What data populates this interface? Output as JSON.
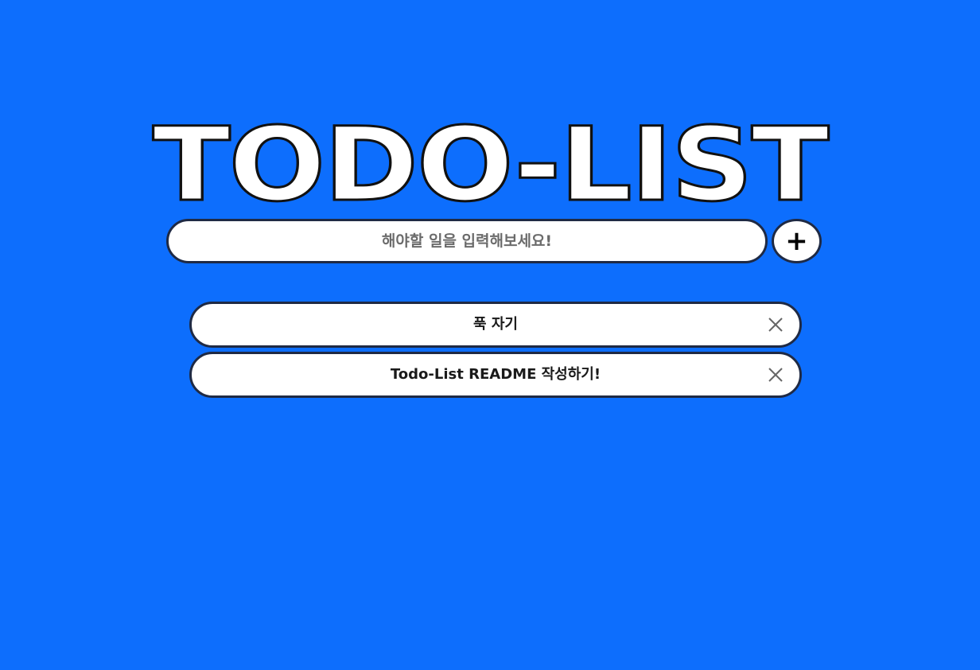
{
  "app": {
    "title": "TODO-LIST",
    "background_color": "#0d6efd"
  },
  "input": {
    "value": "",
    "placeholder": "해야할 일을 입력해보세요!"
  },
  "add_button": {
    "label": "+",
    "icon": "plus-icon"
  },
  "todos": [
    {
      "text": "푹 자기",
      "delete_icon": "close-icon"
    },
    {
      "text": "Todo-List README 작성하기!",
      "delete_icon": "close-icon"
    }
  ]
}
